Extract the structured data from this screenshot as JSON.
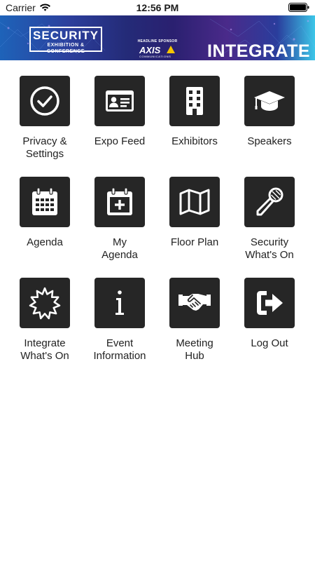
{
  "status_bar": {
    "carrier": "Carrier",
    "time": "12:56 PM"
  },
  "banner": {
    "security_title": "SECURITY",
    "security_subtitle": "EXHIBITION & CONFERENCE",
    "sponsor_label": "HEADLINE SPONSOR",
    "sponsor_name": "AXIS",
    "sponsor_sub": "COMMUNICATIONS",
    "integrate": "INTEGRATE"
  },
  "menu": [
    {
      "label_line1": "Privacy &",
      "label_line2": "Settings",
      "icon": "check-circle-icon"
    },
    {
      "label_line1": "Expo Feed",
      "label_line2": "",
      "icon": "id-card-icon"
    },
    {
      "label_line1": "Exhibitors",
      "label_line2": "",
      "icon": "building-icon"
    },
    {
      "label_line1": "Speakers",
      "label_line2": "",
      "icon": "graduation-cap-icon"
    },
    {
      "label_line1": "Agenda",
      "label_line2": "",
      "icon": "calendar-icon"
    },
    {
      "label_line1": "My",
      "label_line2": "Agenda",
      "icon": "calendar-plus-icon"
    },
    {
      "label_line1": "Floor Plan",
      "label_line2": "",
      "icon": "map-icon"
    },
    {
      "label_line1": "Security",
      "label_line2": "What's On",
      "icon": "microphone-icon"
    },
    {
      "label_line1": "Integrate",
      "label_line2": "What's On",
      "icon": "starburst-icon"
    },
    {
      "label_line1": "Event",
      "label_line2": "Information",
      "icon": "info-icon"
    },
    {
      "label_line1": "Meeting",
      "label_line2": "Hub",
      "icon": "handshake-icon"
    },
    {
      "label_line1": "Log Out",
      "label_line2": "",
      "icon": "sign-out-icon"
    }
  ]
}
